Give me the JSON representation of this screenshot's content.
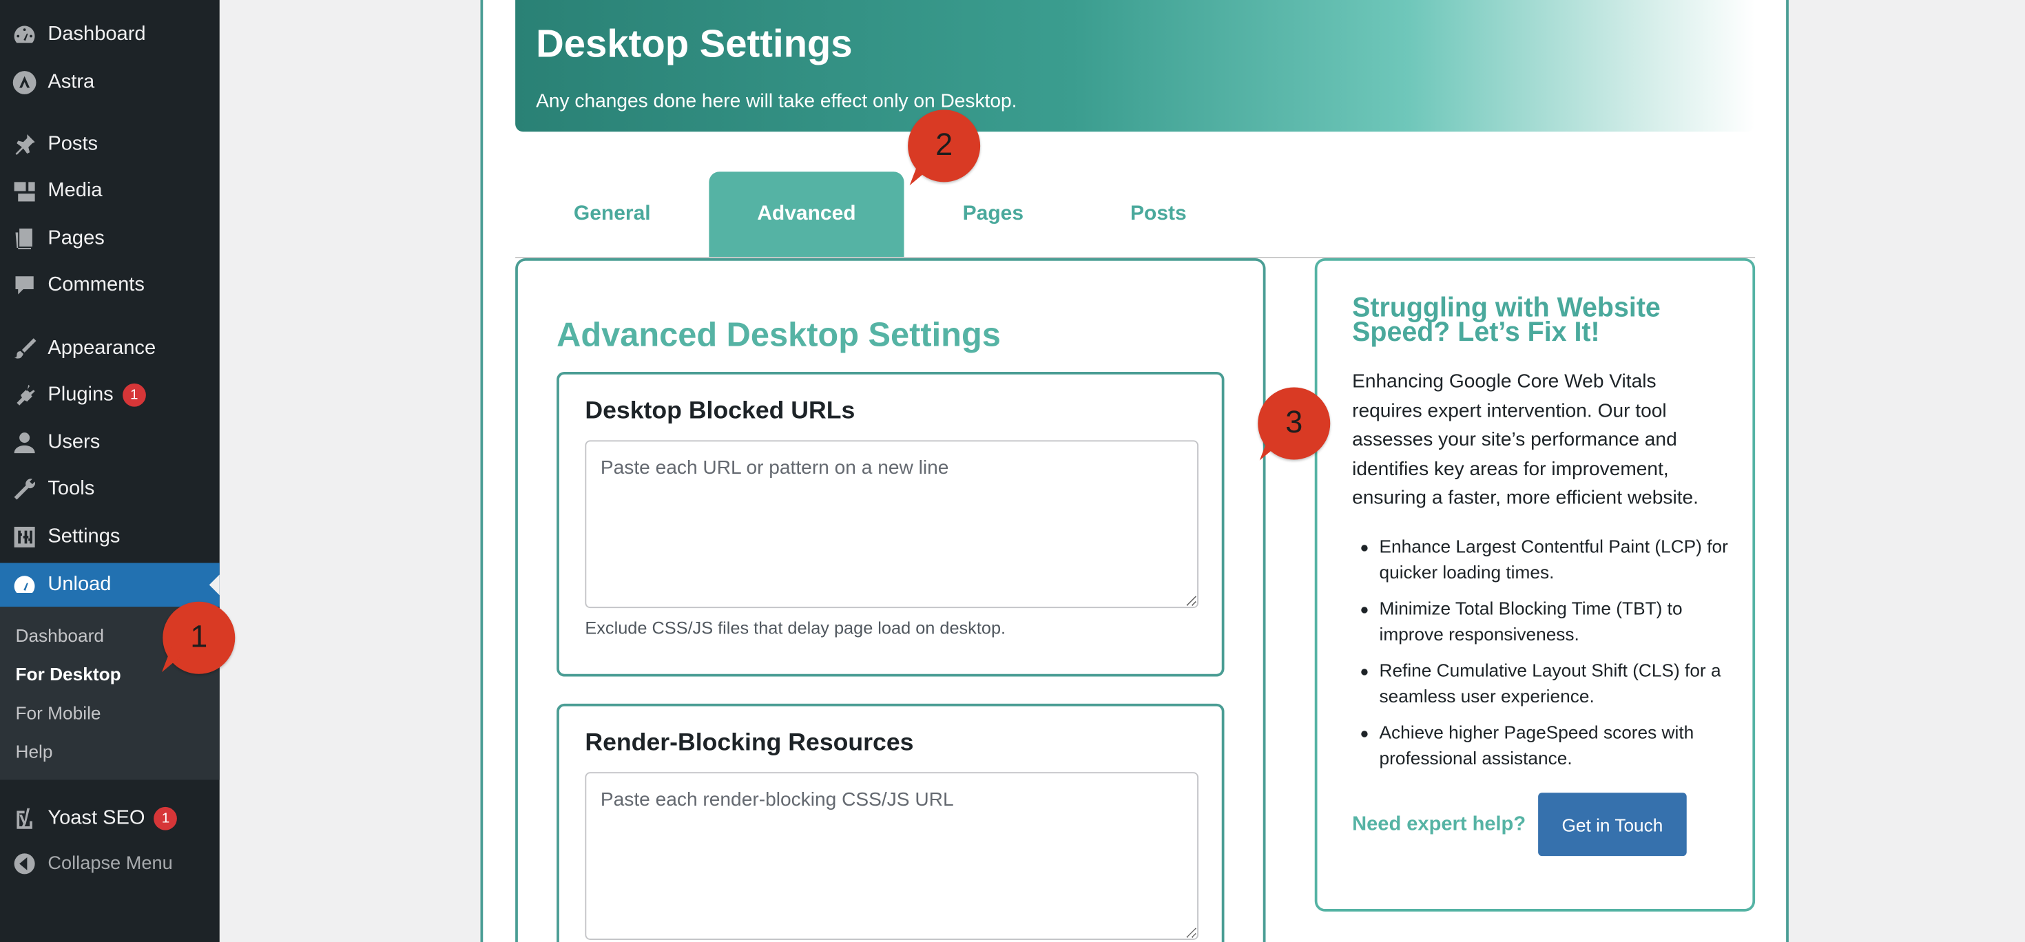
{
  "sidebar": {
    "items": [
      {
        "label": "Dashboard",
        "icon": "dashboard-icon"
      },
      {
        "label": "Astra",
        "icon": "astra-icon"
      },
      {
        "label": "Posts",
        "icon": "pushpin-icon"
      },
      {
        "label": "Media",
        "icon": "media-icon"
      },
      {
        "label": "Pages",
        "icon": "pages-icon"
      },
      {
        "label": "Comments",
        "icon": "comment-icon"
      },
      {
        "label": "Appearance",
        "icon": "paintbrush-icon"
      },
      {
        "label": "Plugins",
        "icon": "plugin-icon",
        "badge": "1"
      },
      {
        "label": "Users",
        "icon": "user-icon"
      },
      {
        "label": "Tools",
        "icon": "wrench-icon"
      },
      {
        "label": "Settings",
        "icon": "settings-icon"
      },
      {
        "label": "Unload",
        "icon": "gauge-icon"
      },
      {
        "label": "Yoast SEO",
        "icon": "yoast-icon",
        "badge": "1"
      },
      {
        "label": "Collapse Menu",
        "icon": "collapse-icon"
      }
    ],
    "submenu": [
      "Dashboard",
      "For Desktop",
      "For Mobile",
      "Help"
    ],
    "active_item": "Unload",
    "current_submenu": "For Desktop"
  },
  "header": {
    "title": "Desktop Settings",
    "subtitle": "Any changes done here will take effect only on Desktop."
  },
  "tabs": [
    {
      "label": "General"
    },
    {
      "label": "Advanced",
      "active": true
    },
    {
      "label": "Pages"
    },
    {
      "label": "Posts"
    }
  ],
  "settings": {
    "title": "Advanced Desktop Settings",
    "blocked": {
      "title": "Desktop Blocked URLs",
      "placeholder": "Paste each URL or pattern on a new line",
      "value": "",
      "help": "Exclude CSS/JS files that delay page load on desktop."
    },
    "render": {
      "title": "Render-Blocking Resources",
      "placeholder": "Paste each render-blocking CSS/JS URL",
      "value": ""
    }
  },
  "promo": {
    "title": "Struggling with Website Speed? Let’s Fix It!",
    "text": "Enhancing Google Core Web Vitals requires expert intervention. Our tool assesses your site’s performance and identifies key areas for improvement, ensuring a faster, more efficient website.",
    "bullets": [
      "Enhance Largest Contentful Paint (LCP) for quicker loading times.",
      "Minimize Total Blocking Time (TBT) to improve responsiveness.",
      "Refine Cumulative Layout Shift (CLS) for a seamless user experience.",
      "Achieve higher PageSpeed scores with professional assistance."
    ],
    "help_text": "Need expert help?",
    "button_label": "Get in Touch"
  },
  "markers": [
    "1",
    "2",
    "3"
  ],
  "colors": {
    "sidebar_bg": "#1d2327",
    "active_blue": "#2271b1",
    "teal": "#55b3a4",
    "teal_dark": "#2a8175",
    "marker_red": "#d93a24",
    "button_blue": "#3671ad"
  }
}
